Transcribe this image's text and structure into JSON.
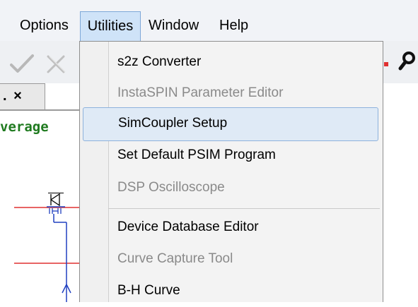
{
  "menubar": {
    "items": [
      {
        "label": "Options"
      },
      {
        "label": "Utilities"
      },
      {
        "label": "Window"
      },
      {
        "label": "Help"
      }
    ],
    "open_menu": "Utilities"
  },
  "tab": {
    "label": ".",
    "close_glyph": "×"
  },
  "canvas": {
    "code_text": "verage"
  },
  "utilities_menu": {
    "items": [
      {
        "label": "s2z Converter",
        "enabled": true
      },
      {
        "label": "InstaSPIN Parameter Editor",
        "enabled": false
      },
      {
        "label": "SimCoupler Setup",
        "enabled": true,
        "highlighted": true
      },
      {
        "label": "Set Default PSIM Program",
        "enabled": true
      },
      {
        "label": "DSP Oscilloscope",
        "enabled": false
      },
      {
        "label": "Device Database Editor",
        "enabled": true
      },
      {
        "label": "Curve Capture Tool",
        "enabled": false
      },
      {
        "label": "B-H Curve",
        "enabled": true
      }
    ]
  },
  "colors": {
    "menu_highlight": "#cfe3f8",
    "item_hover": "#dfeaf6",
    "disabled_text": "#8a8a8a",
    "code_green": "#1f7a1f",
    "wire_red": "#e03030",
    "wire_blue": "#2040c0"
  },
  "icons": [
    "checkmark-icon",
    "cross-icon",
    "magnifier-icon",
    "tab-close-icon",
    "mosfet-icon"
  ]
}
